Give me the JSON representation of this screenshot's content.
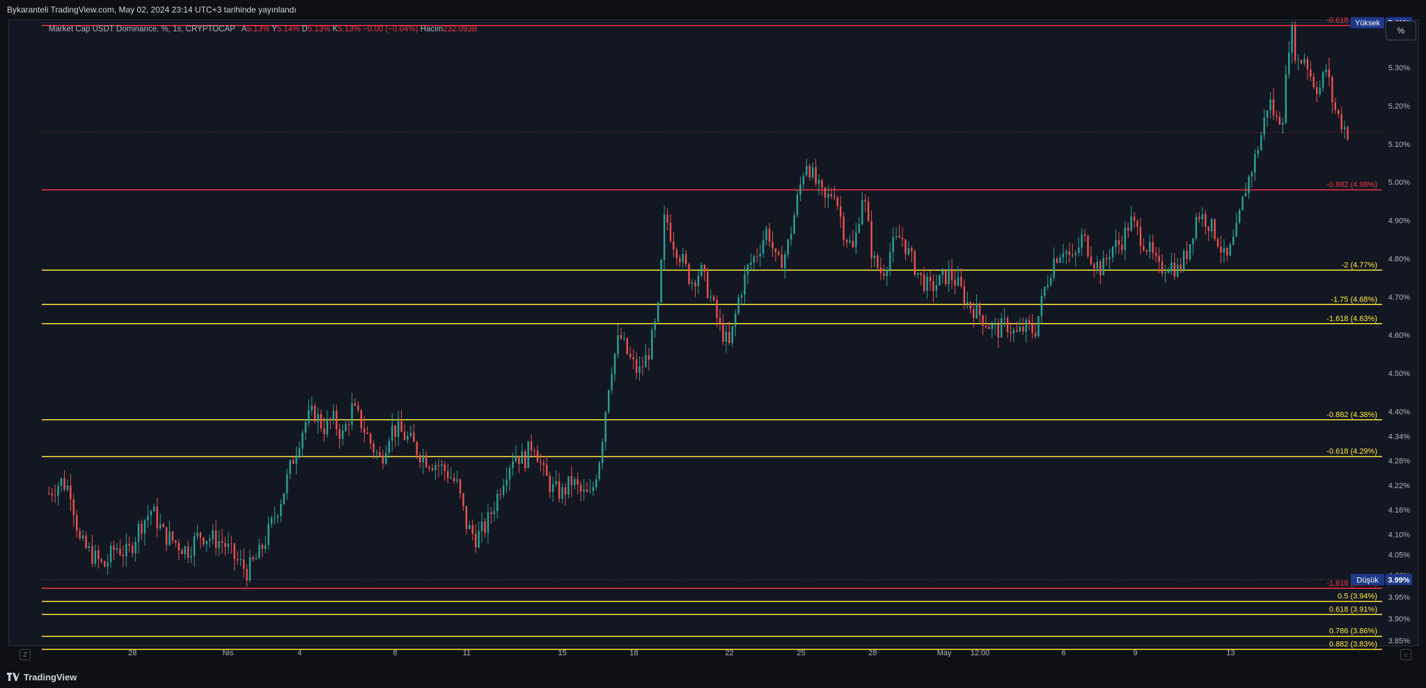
{
  "header": {
    "title": "Bykaranteli TradingView.com, May 02, 2024 23:14 UTC+3 tarihinde yayınlandı"
  },
  "legend": {
    "symbol": "Market Cap USDT Dominance, %, 1s, CRYPTOCAP",
    "open_label": "A",
    "open": "5.13%",
    "high_label": "Y",
    "high": "5.14%",
    "low_label": "D",
    "low": "5.13%",
    "close_label": "K",
    "close": "5.13%",
    "change": "−0.00 (−0.04%)",
    "volume_label": "Hacim",
    "volume": "232.093B"
  },
  "toolbar": {
    "unit_button": "%"
  },
  "footer": {
    "brand": "TradingView",
    "timezone_button": "Z"
  },
  "colors": {
    "background": "#131722",
    "up": "#26a69a",
    "down": "#ef5350",
    "fib_red": "#f23645",
    "fib_yellow": "#ffeb3b",
    "high_badge": "#1e3a8a",
    "axis_text": "#b2b5be"
  },
  "chart_data": {
    "type": "candlestick",
    "title": "",
    "xlabel": "",
    "ylabel": "",
    "ylim": [
      3.85,
      5.45
    ],
    "y_ticks": [
      "5.30%",
      "5.20%",
      "5.10%",
      "5.00%",
      "4.90%",
      "4.80%",
      "4.70%",
      "4.60%",
      "4.50%",
      "4.40%",
      "4.34%",
      "4.28%",
      "4.22%",
      "4.16%",
      "4.10%",
      "4.05%",
      "4.00%",
      "3.95%",
      "3.90%",
      "3.85%"
    ],
    "y_tick_values": [
      5.3,
      5.2,
      5.1,
      5.0,
      4.9,
      4.8,
      4.7,
      4.6,
      4.5,
      4.4,
      4.34,
      4.28,
      4.22,
      4.16,
      4.1,
      4.05,
      4.0,
      3.95,
      3.9,
      3.85
    ],
    "x_ticks": [
      "28",
      "Nis",
      "4",
      "8",
      "11",
      "15",
      "18",
      "22",
      "25",
      "28",
      "May",
      "12:00",
      "6",
      "9",
      "13"
    ],
    "x_tick_days": [
      28,
      32,
      35,
      39,
      42,
      46,
      49,
      53,
      56,
      59,
      62,
      63.5,
      67,
      70,
      74
    ],
    "x_range_days": [
      24.2,
      75.2
    ],
    "price_scale_labels": {
      "high": {
        "label": "Yüksek",
        "value": "5.41%",
        "y": 5.41
      },
      "low": {
        "label": "Düşük",
        "value": "3.99%",
        "y": 3.99
      }
    },
    "current_price": 5.13,
    "fib_levels": [
      {
        "label": "-0.618 (5.41%)",
        "value": 5.41,
        "color": "red"
      },
      {
        "label": "-0.882 (4.98%)",
        "value": 4.98,
        "color": "red"
      },
      {
        "label": "-2 (4.77%)",
        "value": 4.77,
        "color": "yellow"
      },
      {
        "label": "-1.75 (4.68%)",
        "value": 4.68,
        "color": "yellow"
      },
      {
        "label": "-1.618 (4.63%)",
        "value": 4.63,
        "color": "yellow"
      },
      {
        "label": "-0.882 (4.38%)",
        "value": 4.38,
        "color": "yellow"
      },
      {
        "label": "-0.618 (4.29%)",
        "value": 4.29,
        "color": "yellow"
      },
      {
        "label": "-1.618 (3.97%)",
        "value": 3.97,
        "color": "red"
      },
      {
        "label": "0.5 (3.94%)",
        "value": 3.94,
        "color": "yellow"
      },
      {
        "label": "0.618 (3.91%)",
        "value": 3.91,
        "color": "yellow"
      },
      {
        "label": "0.786 (3.86%)",
        "value": 3.86,
        "color": "yellow"
      },
      {
        "label": "0.882 (3.83%)",
        "value": 3.83,
        "color": "yellow"
      }
    ],
    "price_path_points": [
      [
        24.5,
        4.2
      ],
      [
        25.0,
        4.23
      ],
      [
        25.4,
        4.21
      ],
      [
        25.8,
        4.08
      ],
      [
        26.3,
        4.05
      ],
      [
        26.8,
        4.02
      ],
      [
        27.3,
        4.07
      ],
      [
        27.8,
        4.05
      ],
      [
        28.3,
        4.12
      ],
      [
        28.8,
        4.16
      ],
      [
        29.3,
        4.1
      ],
      [
        29.8,
        4.08
      ],
      [
        30.3,
        4.06
      ],
      [
        30.8,
        4.1
      ],
      [
        31.3,
        4.09
      ],
      [
        31.8,
        4.08
      ],
      [
        32.3,
        4.04
      ],
      [
        32.8,
        4.01
      ],
      [
        33.3,
        4.05
      ],
      [
        33.8,
        4.12
      ],
      [
        34.3,
        4.2
      ],
      [
        34.8,
        4.3
      ],
      [
        35.2,
        4.37
      ],
      [
        35.6,
        4.4
      ],
      [
        36.0,
        4.36
      ],
      [
        36.4,
        4.38
      ],
      [
        36.8,
        4.34
      ],
      [
        37.2,
        4.41
      ],
      [
        37.6,
        4.37
      ],
      [
        38.0,
        4.32
      ],
      [
        38.4,
        4.28
      ],
      [
        38.8,
        4.36
      ],
      [
        39.2,
        4.35
      ],
      [
        39.6,
        4.33
      ],
      [
        40.0,
        4.3
      ],
      [
        40.4,
        4.28
      ],
      [
        40.8,
        4.27
      ],
      [
        41.2,
        4.25
      ],
      [
        41.6,
        4.22
      ],
      [
        42.0,
        4.12
      ],
      [
        42.4,
        4.09
      ],
      [
        42.8,
        4.12
      ],
      [
        43.2,
        4.18
      ],
      [
        43.6,
        4.25
      ],
      [
        44.0,
        4.3
      ],
      [
        44.4,
        4.28
      ],
      [
        44.8,
        4.33
      ],
      [
        45.2,
        4.25
      ],
      [
        45.6,
        4.21
      ],
      [
        46.0,
        4.2
      ],
      [
        46.4,
        4.23
      ],
      [
        46.8,
        4.2
      ],
      [
        47.2,
        4.19
      ],
      [
        47.6,
        4.3
      ],
      [
        48.0,
        4.5
      ],
      [
        48.4,
        4.6
      ],
      [
        48.8,
        4.54
      ],
      [
        49.2,
        4.5
      ],
      [
        49.6,
        4.55
      ],
      [
        50.0,
        4.65
      ],
      [
        50.3,
        4.92
      ],
      [
        50.6,
        4.85
      ],
      [
        51.0,
        4.8
      ],
      [
        51.4,
        4.74
      ],
      [
        51.8,
        4.77
      ],
      [
        52.2,
        4.7
      ],
      [
        52.6,
        4.62
      ],
      [
        53.0,
        4.57
      ],
      [
        53.4,
        4.7
      ],
      [
        53.8,
        4.78
      ],
      [
        54.2,
        4.82
      ],
      [
        54.6,
        4.88
      ],
      [
        55.0,
        4.78
      ],
      [
        55.4,
        4.82
      ],
      [
        55.8,
        4.94
      ],
      [
        56.2,
        5.06
      ],
      [
        56.6,
        5.0
      ],
      [
        57.0,
        4.95
      ],
      [
        57.4,
        4.98
      ],
      [
        57.8,
        4.87
      ],
      [
        58.2,
        4.82
      ],
      [
        58.6,
        4.98
      ],
      [
        59.0,
        4.8
      ],
      [
        59.4,
        4.76
      ],
      [
        59.8,
        4.83
      ],
      [
        60.2,
        4.86
      ],
      [
        60.6,
        4.8
      ],
      [
        61.0,
        4.75
      ],
      [
        61.4,
        4.72
      ],
      [
        61.8,
        4.74
      ],
      [
        62.2,
        4.76
      ],
      [
        62.6,
        4.73
      ],
      [
        63.0,
        4.68
      ],
      [
        63.4,
        4.66
      ],
      [
        63.8,
        4.63
      ],
      [
        64.2,
        4.61
      ],
      [
        64.6,
        4.63
      ],
      [
        65.0,
        4.6
      ],
      [
        65.4,
        4.62
      ],
      [
        65.8,
        4.61
      ],
      [
        66.2,
        4.72
      ],
      [
        66.6,
        4.8
      ],
      [
        67.0,
        4.83
      ],
      [
        67.4,
        4.79
      ],
      [
        67.8,
        4.86
      ],
      [
        68.2,
        4.8
      ],
      [
        68.6,
        4.77
      ],
      [
        69.0,
        4.83
      ],
      [
        69.4,
        4.84
      ],
      [
        69.8,
        4.9
      ],
      [
        70.2,
        4.86
      ],
      [
        70.6,
        4.82
      ],
      [
        71.0,
        4.77
      ],
      [
        71.4,
        4.79
      ],
      [
        71.8,
        4.77
      ],
      [
        72.2,
        4.82
      ],
      [
        72.6,
        4.92
      ],
      [
        73.0,
        4.9
      ],
      [
        73.4,
        4.86
      ],
      [
        73.8,
        4.79
      ],
      [
        74.2,
        4.86
      ],
      [
        74.6,
        4.98
      ],
      [
        75.0,
        5.06
      ],
      [
        75.3,
        5.13
      ],
      [
        75.6,
        5.22
      ],
      [
        75.9,
        5.16
      ],
      [
        76.2,
        5.18
      ],
      [
        76.5,
        5.41
      ],
      [
        76.8,
        5.31
      ],
      [
        77.1,
        5.33
      ],
      [
        77.4,
        5.27
      ],
      [
        77.7,
        5.24
      ],
      [
        78.0,
        5.3
      ],
      [
        78.3,
        5.2
      ],
      [
        78.6,
        5.16
      ],
      [
        78.9,
        5.13
      ]
    ]
  }
}
